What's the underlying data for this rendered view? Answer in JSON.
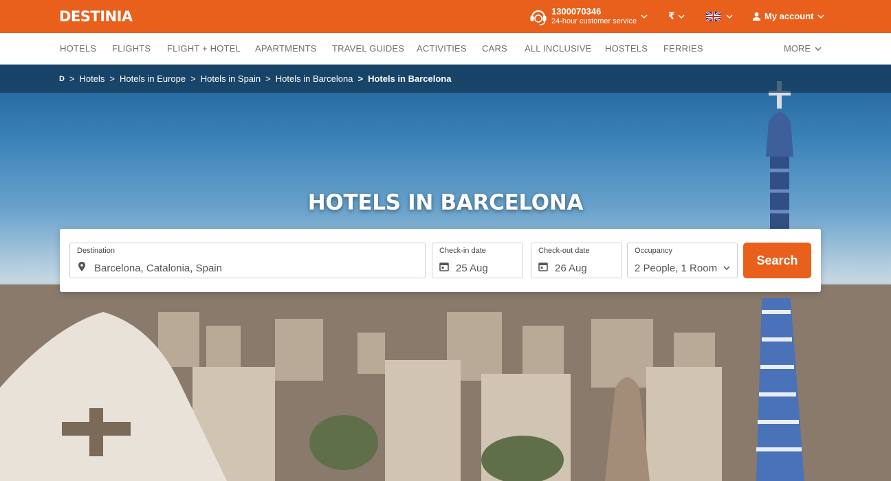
{
  "brand": {
    "logo": "DESTINIA",
    "color": "#e8601c"
  },
  "header": {
    "phone": "1300070346",
    "service": "24-hour customer service",
    "currency": "₹",
    "language_flag": "uk-flag-icon",
    "account": "My account"
  },
  "nav": {
    "items": [
      "HOTELS",
      "FLIGHTS",
      "FLIGHT + HOTEL",
      "APARTMENTS",
      "TRAVEL GUIDES",
      "ACTIVITIES",
      "CARS",
      "ALL INCLUSIVE",
      "HOSTELS",
      "FERRIES"
    ],
    "more": "MORE"
  },
  "breadcrumb": {
    "home": "D",
    "items": [
      "Hotels",
      "Hotels in Europe",
      "Hotels in Spain",
      "Hotels in Barcelona"
    ],
    "current": "Hotels in Barcelona"
  },
  "hero": {
    "title": "HOTELS IN BARCELONA"
  },
  "search": {
    "destination": {
      "label": "Destination",
      "value": "Barcelona, Catalonia, Spain"
    },
    "checkin": {
      "label": "Check-in date",
      "value": "25 Aug"
    },
    "checkout": {
      "label": "Check-out date",
      "value": "26 Aug"
    },
    "occupancy": {
      "label": "Occupancy",
      "value": "2 People, 1 Room"
    },
    "button": "Search"
  }
}
